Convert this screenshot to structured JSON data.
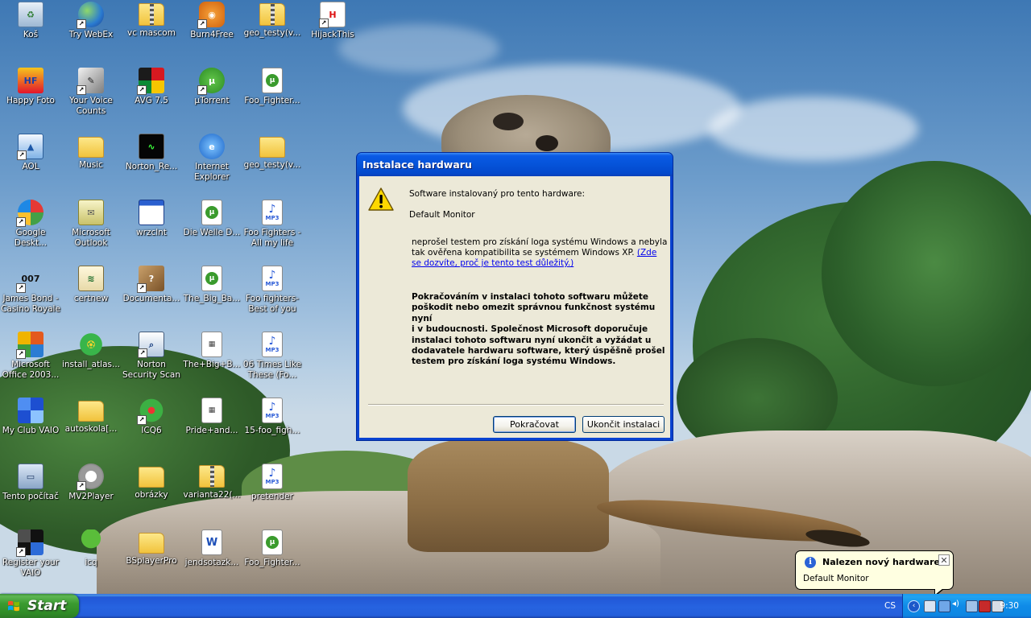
{
  "desktop": {
    "icons": [
      {
        "label": "Koš",
        "icon": "recycle-bin-icon",
        "shortcut": false
      },
      {
        "label": "Try WebEx",
        "icon": "webex-globe-icon",
        "shortcut": true
      },
      {
        "label": "vc mascom",
        "icon": "zip-folder-icon",
        "shortcut": false
      },
      {
        "label": "Burn4Free",
        "icon": "burn4free-icon",
        "shortcut": true
      },
      {
        "label": "geo_testy(v...",
        "icon": "zip-folder-icon",
        "shortcut": false
      },
      {
        "label": "HijackThis",
        "icon": "hijackthis-icon",
        "shortcut": true
      },
      {
        "label": "Happy Foto",
        "icon": "happy-foto-icon",
        "shortcut": false
      },
      {
        "label": "Your Voice\nCounts",
        "icon": "pen-icon",
        "shortcut": true
      },
      {
        "label": "AVG 7.5",
        "icon": "avg-icon",
        "shortcut": true
      },
      {
        "label": "µTorrent",
        "icon": "utorrent-icon",
        "shortcut": true
      },
      {
        "label": "Foo_Fighter...",
        "icon": "torrent-file-icon",
        "shortcut": false
      },
      {
        "label": "AOL",
        "icon": "aol-icon",
        "shortcut": true
      },
      {
        "label": "Music",
        "icon": "folder-icon",
        "shortcut": false
      },
      {
        "label": "Norton_Re...",
        "icon": "norton-monitor-icon",
        "shortcut": false
      },
      {
        "label": "Internet\nExplorer",
        "icon": "internet-explorer-icon",
        "shortcut": false
      },
      {
        "label": "geo_testy(v...",
        "icon": "folder-icon",
        "shortcut": false
      },
      {
        "label": "Google\nDeskt...",
        "icon": "google-desktop-icon",
        "shortcut": true
      },
      {
        "label": "Microsoft\nOutlook",
        "icon": "outlook-icon",
        "shortcut": false
      },
      {
        "label": "wrzclnt",
        "icon": "window-app-icon",
        "shortcut": false
      },
      {
        "label": "Die Welle D...",
        "icon": "torrent-file-icon",
        "shortcut": false
      },
      {
        "label": "Foo Fighters -\nAll my life",
        "icon": "mp3-file-icon",
        "shortcut": false
      },
      {
        "label": "James Bond -\nCasino Royale",
        "icon": "james-bond-icon",
        "shortcut": true
      },
      {
        "label": "certnew",
        "icon": "certificate-icon",
        "shortcut": false
      },
      {
        "label": "Documenta...",
        "icon": "help-book-icon",
        "shortcut": true
      },
      {
        "label": "The_Big_Ba...",
        "icon": "torrent-file-icon",
        "shortcut": false
      },
      {
        "label": "Foo fighters-\nBest of you",
        "icon": "mp3-file-icon",
        "shortcut": false
      },
      {
        "label": "Microsoft\nOffice 2003...",
        "icon": "office-icon",
        "shortcut": true
      },
      {
        "label": "install_atlas...",
        "icon": "icq-install-icon",
        "shortcut": false
      },
      {
        "label": "Norton\nSecurity Scan",
        "icon": "norton-scan-icon",
        "shortcut": true
      },
      {
        "label": "The+Big+B...",
        "icon": "media-file-icon",
        "shortcut": false
      },
      {
        "label": "06 Times Like\nThese (Fo...",
        "icon": "mp3-file-icon",
        "shortcut": false
      },
      {
        "label": "My Club VAIO",
        "icon": "vaio-club-icon",
        "shortcut": false
      },
      {
        "label": "autoskola[...",
        "icon": "folder-icon",
        "shortcut": false
      },
      {
        "label": "ICQ6",
        "icon": "icq-flower-icon",
        "shortcut": true
      },
      {
        "label": "Pride+and...",
        "icon": "media-file-icon",
        "shortcut": false
      },
      {
        "label": "15-foo_figh...",
        "icon": "mp3-file-icon",
        "shortcut": false
      },
      {
        "label": "Tento počítač",
        "icon": "my-computer-icon",
        "shortcut": false
      },
      {
        "label": "MV2Player",
        "icon": "mv2player-icon",
        "shortcut": true
      },
      {
        "label": "obrázky",
        "icon": "folder-icon",
        "shortcut": false
      },
      {
        "label": "varianta22(...",
        "icon": "zip-folder-icon",
        "shortcut": false
      },
      {
        "label": "pretender",
        "icon": "mp3-file-icon",
        "shortcut": false
      },
      {
        "label": "Register your\nVAIO",
        "icon": "vaio-register-icon",
        "shortcut": true
      },
      {
        "label": "icq",
        "icon": "tree-icon",
        "shortcut": false
      },
      {
        "label": "BSplayerPro",
        "icon": "folder-icon",
        "shortcut": false
      },
      {
        "label": "jendsotazk...",
        "icon": "word-document-icon",
        "shortcut": false
      },
      {
        "label": "Foo_Fighter...",
        "icon": "torrent-file-icon",
        "shortcut": false
      }
    ]
  },
  "dialog": {
    "title": "Instalace hardwaru",
    "icon": "warning-icon",
    "intro": "Software instalovaný pro tento hardware:",
    "device": "Default Monitor",
    "body1": "neprošel testem pro získání loga systému Windows a nebyla tak ověřena kompatibilita se systémem Windows XP. ",
    "link": "(Zde se dozvíte, proč je tento test důležitý.)",
    "warning_lines": [
      "Pokračováním v instalaci tohoto softwaru můžete",
      "poškodit nebo omezit správnou funkčnost systému nyní",
      "i v budoucnosti. Společnost Microsoft doporučuje",
      "instalaci tohoto softwaru nyní ukončit a vyžádat u",
      "dodavatele hardwaru software, který úspěšně prošel",
      "testem pro získání loga systému Windows."
    ],
    "continue_label": "Pokračovat",
    "stop_label": "Ukončit instalaci"
  },
  "balloon": {
    "icon": "info-icon",
    "title": "Nalezen nový hardware",
    "text": "Default Monitor",
    "close_glyph": "✕"
  },
  "taskbar": {
    "start_label": "Start",
    "language": "CS",
    "clock": "9:30",
    "tray_icons": [
      "back-arrow-icon",
      "hardware-icon",
      "network-icon",
      "volume-icon",
      "monitor-icon",
      "security-alert-icon",
      "laptop-icon"
    ]
  },
  "colors": {
    "taskbar_blue": "#245edb",
    "start_green": "#3b9b30",
    "tray_blue": "#0f8be8",
    "dialog_title_blue": "#0553d9",
    "dialog_face": "#ece9d8",
    "balloon_bg": "#ffffe1"
  }
}
